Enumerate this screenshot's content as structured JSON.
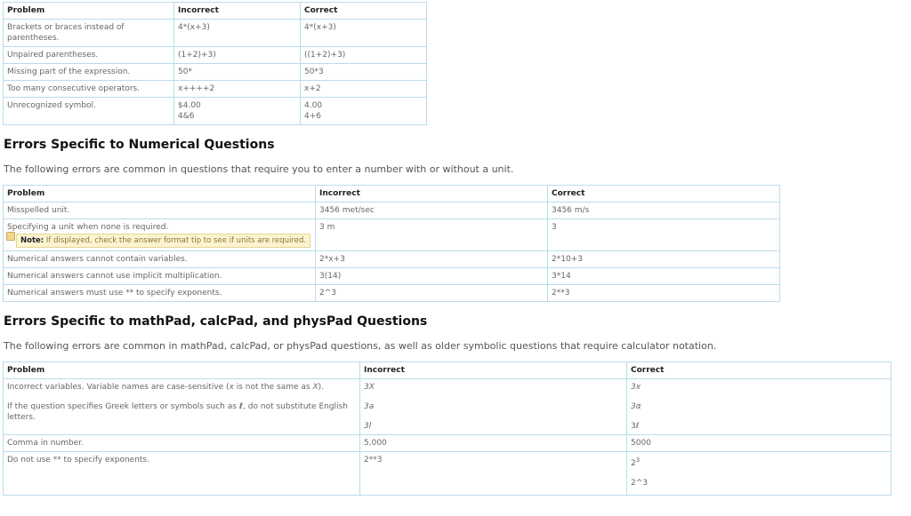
{
  "table1": {
    "headers": [
      "Problem",
      "Incorrect",
      "Correct"
    ],
    "rows": [
      {
        "problem": "Brackets or braces instead of parentheses.",
        "incorrect": "4*(x+3)",
        "correct": "4*(x+3)"
      },
      {
        "problem": "Unpaired parentheses.",
        "incorrect": "(1+2)+3)",
        "correct": "((1+2)+3)"
      },
      {
        "problem": "Missing part of the expression.",
        "incorrect": "50*",
        "correct": "50*3"
      },
      {
        "problem": "Too many consecutive operators.",
        "incorrect": "x++++2",
        "correct": "x+2"
      },
      {
        "problem": "Unrecognized symbol.",
        "incorrect": [
          "$4.00",
          "4&6"
        ],
        "correct": [
          "4.00",
          "4+6"
        ]
      }
    ]
  },
  "section2": {
    "heading": "Errors Specific to Numerical Questions",
    "intro": "The following errors are common in questions that require you to enter a number with or without a unit.",
    "headers": [
      "Problem",
      "Incorrect",
      "Correct"
    ],
    "rows": [
      {
        "problem": "Misspelled unit.",
        "incorrect": "3456 met/sec",
        "correct": "3456 m/s"
      },
      {
        "problem": "Specifying a unit when none is required.",
        "note_label": "Note:",
        "note_text": "If displayed, check the answer format tip to see if units are required.",
        "incorrect": "3 m",
        "correct": "3"
      },
      {
        "problem": "Numerical answers cannot contain variables.",
        "incorrect": "2*x+3",
        "correct": "2*10+3"
      },
      {
        "problem": "Numerical answers cannot use implicit multiplication.",
        "incorrect": "3(14)",
        "correct": "3*14"
      },
      {
        "problem": "Numerical answers must use ** to specify exponents.",
        "incorrect": "2^3",
        "correct": "2**3"
      }
    ]
  },
  "section3": {
    "heading": "Errors Specific to mathPad, calcPad, and physPad Questions",
    "intro": "The following errors are common in mathPad, calcPad, or physPad questions, as well as older symbolic questions that require calculator notation.",
    "headers": [
      "Problem",
      "Incorrect",
      "Correct"
    ],
    "row1": {
      "problem_a_pre": "Incorrect variables. Variable names are case-sensitive (",
      "problem_a_x1": "x",
      "problem_a_mid": " is not the same as ",
      "problem_a_x2": "X",
      "problem_a_post": ").",
      "problem_b_pre": "If the question specifies Greek letters or symbols such as ",
      "problem_b_sym": "ℓ",
      "problem_b_post": ", do not substitute English letters.",
      "incorrect": [
        "3X",
        "3a",
        "3l"
      ],
      "correct": [
        "3x",
        "3α",
        "3ℓ"
      ]
    },
    "row2": {
      "problem": "Comma in number.",
      "incorrect": "5,000",
      "correct": "5000"
    },
    "row3": {
      "problem": "Do not use ** to specify exponents.",
      "incorrect": "2**3",
      "correct_base": "2",
      "correct_sup": "3",
      "correct_alt": "2^3"
    }
  }
}
